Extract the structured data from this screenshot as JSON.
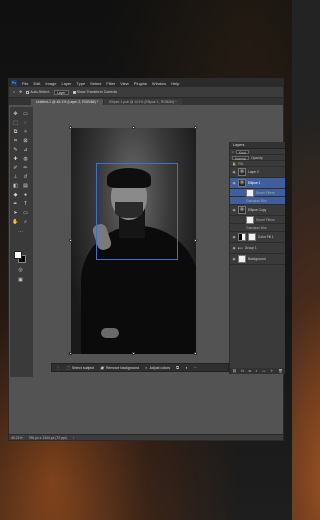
{
  "window": {
    "title": "Photoshop"
  },
  "menubar": {
    "logo": "Ps",
    "items": [
      "File",
      "Edit",
      "Image",
      "Layer",
      "Type",
      "Select",
      "Filter",
      "View",
      "Plugins",
      "Window",
      "Help"
    ]
  },
  "options": {
    "home_icon": "home-icon",
    "move_icon": "move-icon",
    "auto_select": "Auto-Select:",
    "auto_select_target": "Layer",
    "transform": "Show Transform Controls"
  },
  "tabs": [
    {
      "label": "Untitled-1 @ 45.1% (Layer 2, RGB/8#) *",
      "active": true
    },
    {
      "label": "Ellipse 1.psb @ 101% (Ellipse 1, RGB/8#) *",
      "active": false
    }
  ],
  "context_bar": {
    "select_subject": "Select subject",
    "remove_background": "Remove background",
    "adjust_colors": "Adjust colors"
  },
  "layers_panel": {
    "title": "Layers",
    "kind": "Kind",
    "mode": "Normal",
    "opacity": "Opacity:",
    "fill": "Fill:",
    "layers": [
      {
        "name": "Layer 2",
        "thumb": "photo",
        "selected": false,
        "sub": false
      },
      {
        "name": "Ellipse 1",
        "thumb": "photo",
        "selected": true,
        "sub": false
      },
      {
        "name": "Smart Filters",
        "thumb": "white",
        "selected": true,
        "sub": true
      },
      {
        "name": "Gaussian Blur",
        "thumb": "none",
        "selected": true,
        "sub": true
      },
      {
        "name": "Ellipse Copy",
        "thumb": "photo",
        "selected": false,
        "sub": false
      },
      {
        "name": "Smart Filters",
        "thumb": "white",
        "selected": false,
        "sub": true
      },
      {
        "name": "Gaussian Blur",
        "thumb": "none",
        "selected": false,
        "sub": true
      },
      {
        "name": "Color Fill 1",
        "thumb": "half",
        "selected": false,
        "sub": false
      },
      {
        "name": "Group 1",
        "thumb": "none",
        "selected": false,
        "sub": false
      },
      {
        "name": "Background",
        "thumb": "white",
        "selected": false,
        "sub": false
      }
    ]
  },
  "status": {
    "zoom": "45.21%",
    "doc_size": "796 px x 1344 px (72 ppi)"
  }
}
